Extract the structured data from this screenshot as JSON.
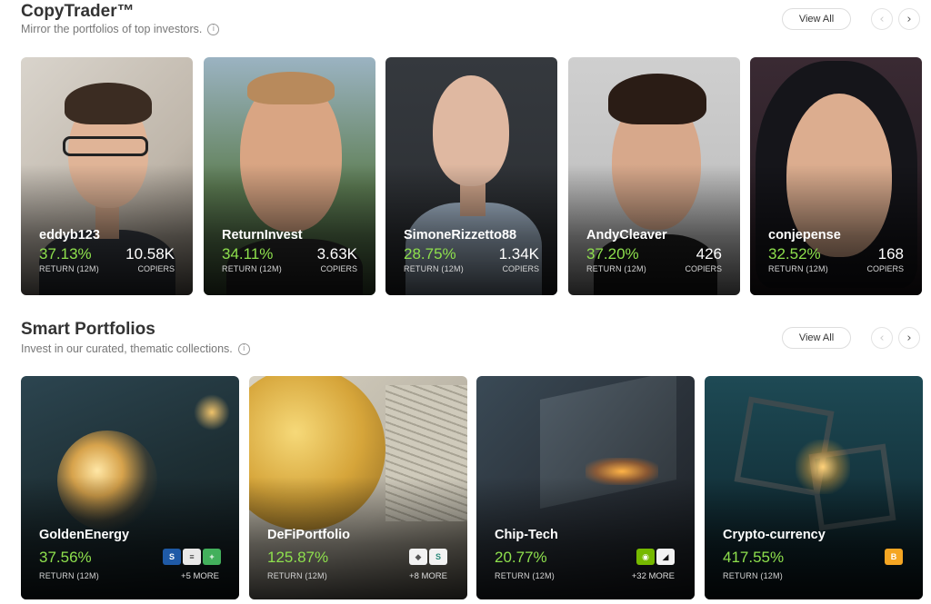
{
  "copytrader": {
    "title": "CopyTrader™",
    "subtitle": "Mirror the portfolios of top investors.",
    "view_all": "View All",
    "traders": [
      {
        "name": "eddyb123",
        "return": "37.13%",
        "return_label": "RETURN (12M)",
        "copiers": "10.58K",
        "copiers_label": "COPIERS"
      },
      {
        "name": "ReturnInvest",
        "return": "34.11%",
        "return_label": "RETURN (12M)",
        "copiers": "3.63K",
        "copiers_label": "COPIERS"
      },
      {
        "name": "SimoneRizzetto88",
        "return": "28.75%",
        "return_label": "RETURN (12M)",
        "copiers": "1.34K",
        "copiers_label": "COPIERS"
      },
      {
        "name": "AndyCleaver",
        "return": "37.20%",
        "return_label": "RETURN (12M)",
        "copiers": "426",
        "copiers_label": "COPIERS"
      },
      {
        "name": "conjepense",
        "return": "32.52%",
        "return_label": "RETURN (12M)",
        "copiers": "168",
        "copiers_label": "COPIERS"
      }
    ]
  },
  "smart_portfolios": {
    "title": "Smart Portfolios",
    "subtitle": "Invest in our curated, thematic collections.",
    "view_all": "View All",
    "portfolios": [
      {
        "name": "GoldenEnergy",
        "return": "37.56%",
        "return_label": "RETURN (12M)",
        "more": "+5 MORE"
      },
      {
        "name": "DeFiPortfolio",
        "return": "125.87%",
        "return_label": "RETURN (12M)",
        "more": "+8 MORE"
      },
      {
        "name": "Chip-Tech",
        "return": "20.77%",
        "return_label": "RETURN (12M)",
        "more": "+32 MORE"
      },
      {
        "name": "Crypto-currency",
        "return": "417.55%",
        "return_label": "RETURN (12M)",
        "more": ""
      }
    ]
  },
  "colors": {
    "return_green": "#8ee04d",
    "title": "#333333"
  },
  "icons": {
    "info": "info-icon",
    "prev": "chevron-left-icon",
    "next": "chevron-right-icon"
  }
}
